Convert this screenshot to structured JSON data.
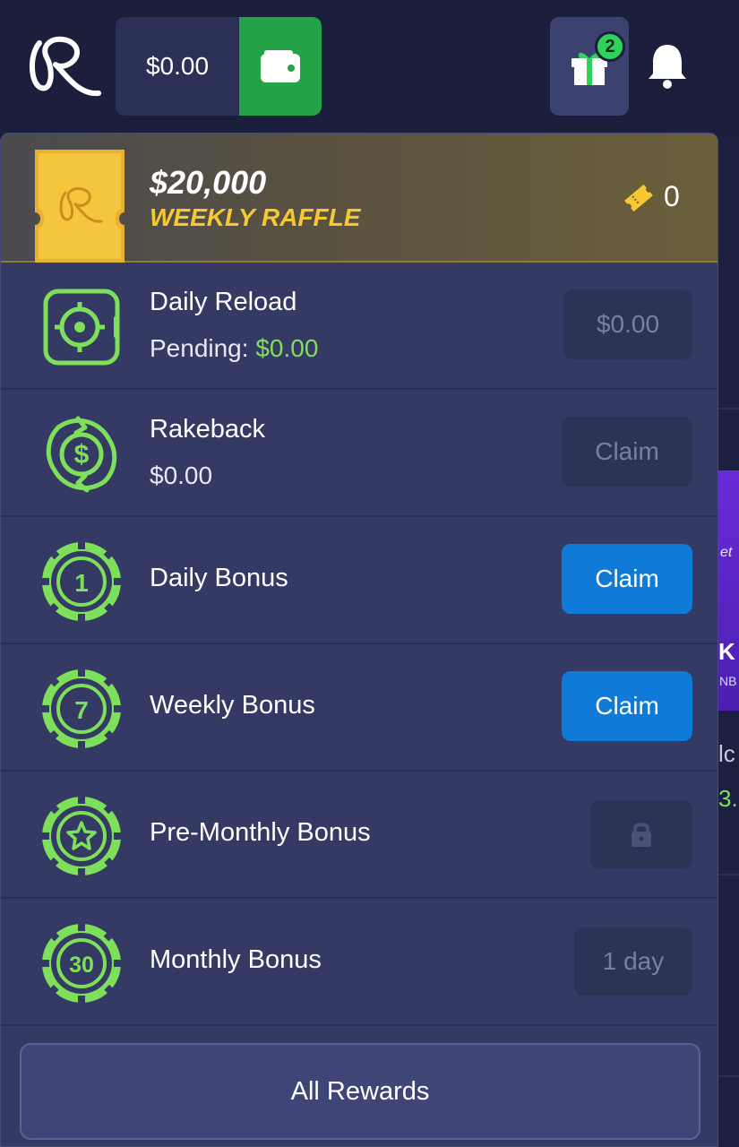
{
  "header": {
    "balance": "$0.00",
    "notification_count": "2"
  },
  "raffle": {
    "amount": "$20,000",
    "title": "WEEKLY RAFFLE",
    "ticket_count": "0"
  },
  "rewards": [
    {
      "title": "Daily Reload",
      "sub_label": "Pending: ",
      "sub_value": "$0.00",
      "action": "$0.00",
      "state": "disabled"
    },
    {
      "title": "Rakeback",
      "sub_value": "$0.00",
      "action": "Claim",
      "state": "disabled"
    },
    {
      "title": "Daily Bonus",
      "icon_text": "1",
      "action": "Claim",
      "state": "active"
    },
    {
      "title": "Weekly Bonus",
      "icon_text": "7",
      "action": "Claim",
      "state": "active"
    },
    {
      "title": "Pre-Monthly Bonus",
      "action_icon": "lock-icon",
      "state": "locked"
    },
    {
      "title": "Monthly Bonus",
      "icon_text": "30",
      "action": "1 day",
      "state": "disabled"
    }
  ],
  "all_rewards_label": "All Rewards",
  "background_page": {
    "promo_fragment_1": "et",
    "promo_fragment_2": "K",
    "promo_fragment_3": "NB",
    "text_fragment_1": "lc",
    "text_fragment_2": "3."
  },
  "colors": {
    "accent_green": "#7ee05a",
    "wallet_green": "#23a247",
    "claim_blue": "#0f7ad8",
    "raffle_gold": "#f7c834",
    "panel_bg": "#343a63",
    "header_bg": "#1b1f3b"
  },
  "icons": {
    "logo": "r-logo",
    "wallet": "wallet-icon",
    "gift": "gift-icon",
    "bell": "bell-icon",
    "raffle_ticket": "ticket-icon",
    "daily_reload": "target-watch-icon",
    "rakeback": "dollar-cycle-icon",
    "daily_bonus": "chip-icon",
    "weekly_bonus": "chip-icon",
    "pre_monthly_bonus": "star-chip-icon",
    "monthly_bonus": "chip-icon"
  }
}
